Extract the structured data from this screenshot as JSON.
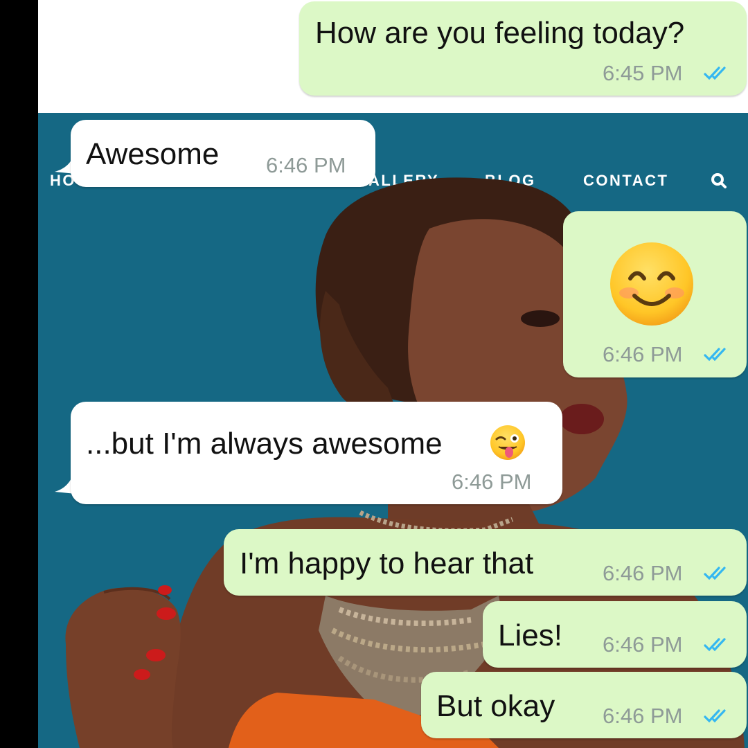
{
  "website": {
    "nav_items": [
      "HO",
      "ALLERY",
      "BLOG",
      "CONTACT"
    ],
    "search_icon": "search-icon",
    "background_color": "#156884"
  },
  "chat": {
    "outgoing_bubble_color": "#dcf8c6",
    "incoming_bubble_color": "#ffffff",
    "read_tick_color": "#34b7f1",
    "messages": [
      {
        "direction": "outgoing",
        "text": "How are you feeling today?",
        "time": "6:45 PM",
        "status": "read"
      },
      {
        "direction": "incoming",
        "text": "Awesome",
        "time": "6:46 PM"
      },
      {
        "direction": "outgoing",
        "text": "",
        "emoji": "smiling-face-emoji",
        "time": "6:46 PM",
        "status": "read"
      },
      {
        "direction": "incoming",
        "text": "...but I'm always awesome",
        "emoji": "winking-face-with-tongue-emoji",
        "time": "6:46 PM"
      },
      {
        "direction": "outgoing",
        "text": "I'm happy to hear that",
        "time": "6:46 PM",
        "status": "read"
      },
      {
        "direction": "outgoing",
        "text": "Lies!",
        "time": "6:46 PM",
        "status": "read"
      },
      {
        "direction": "outgoing",
        "text": "But okay",
        "time": "6:46 PM",
        "status": "read"
      }
    ]
  }
}
